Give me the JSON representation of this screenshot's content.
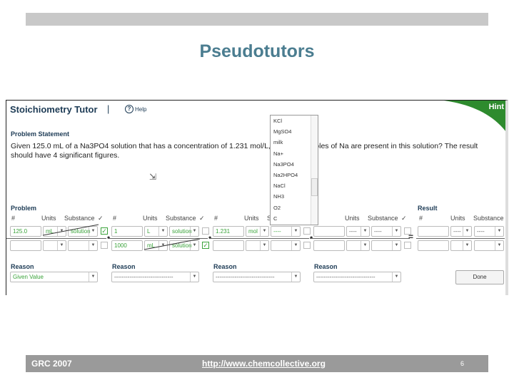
{
  "slide": {
    "title": "Pseudotutors",
    "footer_left": "GRC 2007",
    "footer_link": "http://www.chemcollective.org",
    "page_number": "6"
  },
  "app": {
    "title": "Stoichiometry Tutor",
    "separator": "|",
    "help_label": "Help",
    "hint_label": "Hint",
    "accent": "#2e8b2e",
    "correct_color": "#3aa33a"
  },
  "problem": {
    "heading": "Problem Statement",
    "text": "Given 125.0 mL of a Na3PO4 solution that has a concentration of 1.231 mol/L, how many moles of Na  are present in this solution? The result should have 4 significant figures."
  },
  "headers": {
    "problem": "Problem",
    "result": "Result",
    "number": "#",
    "units": "Units",
    "substance": "Substance",
    "check": "✓"
  },
  "columns": [
    {
      "top": {
        "number": "125.0",
        "units": "mL",
        "substance": "solution",
        "checked": true,
        "correct": true
      },
      "bottom": {
        "number": "",
        "units": "",
        "substance": "",
        "checked": false,
        "correct": false
      },
      "reason": "Given Value",
      "reason_correct": true
    },
    {
      "top": {
        "number": "1",
        "units": "L",
        "substance": "solution",
        "checked": false,
        "correct": true
      },
      "bottom": {
        "number": "1000",
        "units": "mL",
        "substance": "solution",
        "checked": true,
        "correct": true
      },
      "reason": "-------------------------------",
      "reason_correct": false
    },
    {
      "top": {
        "number": "1.231",
        "units": "mol",
        "substance": "----",
        "checked": false,
        "correct": true
      },
      "bottom": {
        "number": "",
        "units": "",
        "substance": "",
        "checked": false,
        "correct": false
      },
      "reason": "-------------------------------",
      "reason_correct": false
    },
    {
      "top": {
        "number": "",
        "units": "----",
        "substance": "----",
        "checked": false,
        "correct": false
      },
      "bottom": {
        "number": "",
        "units": "",
        "substance": "",
        "checked": false,
        "correct": false
      },
      "reason": "-------------------------------",
      "reason_correct": false
    }
  ],
  "result": {
    "top": {
      "number": "",
      "units": "----",
      "substance": "----"
    },
    "bottom": {
      "number": "",
      "units": "",
      "substance": ""
    }
  },
  "reason_label": "Reason",
  "operators": {
    "multiply": "•",
    "equals": "="
  },
  "substance_dropdown": {
    "options": [
      "KCl",
      "MgSO4",
      "milk",
      "Na+",
      "Na3PO4",
      "Na2HPO4",
      "NaCl",
      "NH3",
      "O2",
      "C"
    ]
  },
  "done_label": "Done"
}
